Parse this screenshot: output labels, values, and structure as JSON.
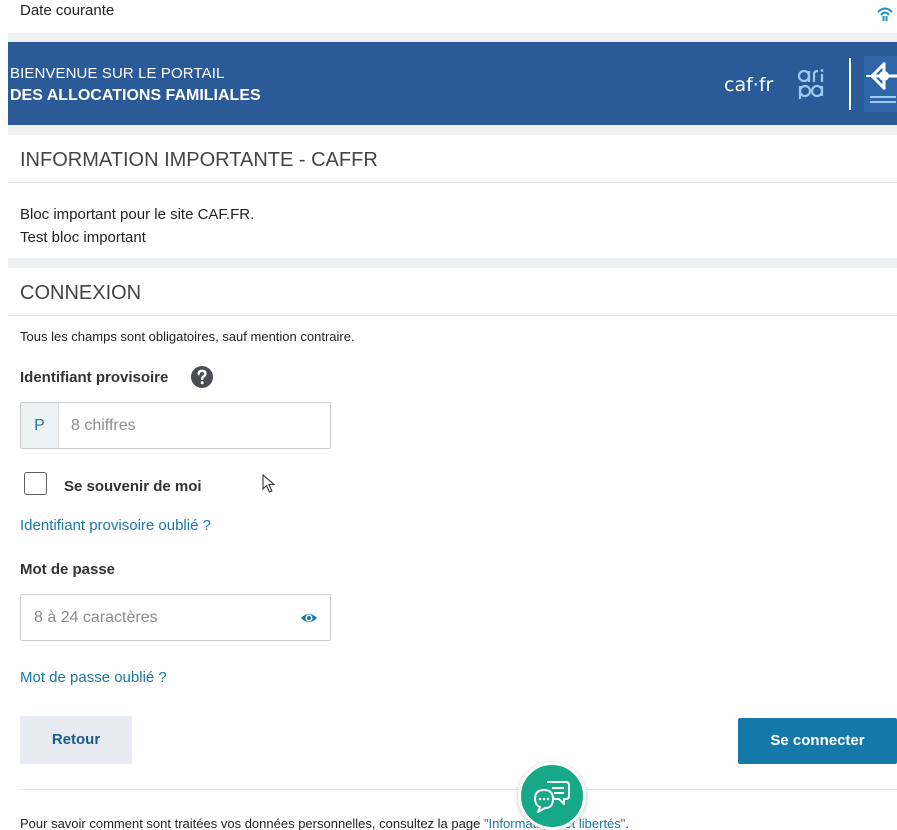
{
  "top": {
    "date_label": "Date courante",
    "wifi_icon": "wifi-icon"
  },
  "banner": {
    "line1": "BIENVENUE SUR LE PORTAIL",
    "line2": "DES ALLOCATIONS FAMILIALES",
    "logo_caf": "caf·fr",
    "logo_aripa": "aripa-logo",
    "logo_caf2": "caf-allocations-familiales-logo",
    "background_color": "#2b5a98"
  },
  "important": {
    "title": "INFORMATION IMPORTANTE - CAFFR",
    "line1": "Bloc important pour le site CAF.FR.",
    "line2": "Test bloc important"
  },
  "connexion": {
    "title": "CONNEXION",
    "note": "Tous les champs sont obligatoires, sauf mention contraire.",
    "identifiant_label": "Identifiant provisoire",
    "help_icon": "question-circle-icon",
    "identifiant_prefix": "P",
    "identifiant_placeholder": "8 chiffres",
    "identifiant_value": "",
    "remember_label": "Se souvenir de moi",
    "remember_checked": false,
    "forgot_id_link": "Identifiant provisoire oublié ?",
    "password_label": "Mot de passe",
    "password_placeholder": "8 à 24 caractères",
    "password_value": "",
    "eye_icon": "eye-icon",
    "forgot_password_link": "Mot de passe oublié ?",
    "back_button": "Retour",
    "connect_button": "Se connecter",
    "accent_color": "#1479a8"
  },
  "footer": {
    "text_before": "Pour savoir comment sont traitées vos données personnelles, consultez la page ",
    "link_text": "\"Informatique et libertés\"",
    "text_after": "."
  },
  "chat": {
    "icon": "chat-bubbles-icon",
    "color": "#17a887"
  }
}
